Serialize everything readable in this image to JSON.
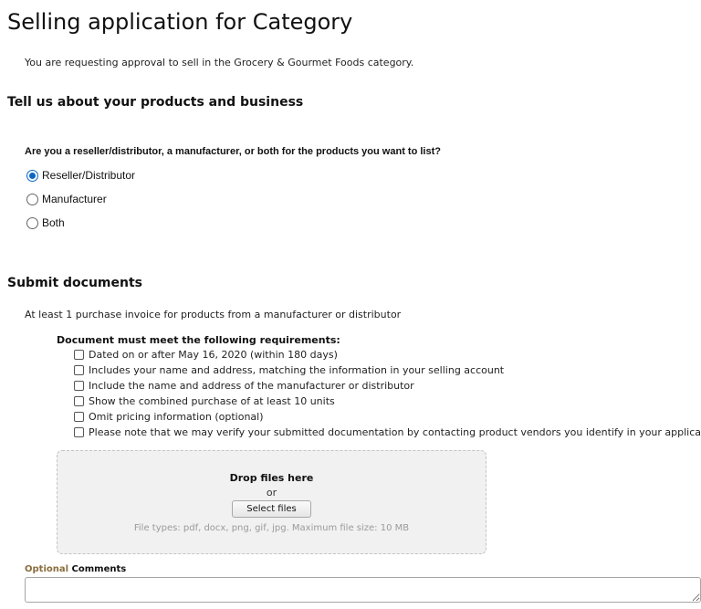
{
  "header": {
    "title": "Selling application for Category",
    "intro": "You are requesting approval to sell in the Grocery & Gourmet Foods category."
  },
  "business_section": {
    "heading": "Tell us about your products and business",
    "question": "Are you a reseller/distributor, a manufacturer, or both for the products you want to list?",
    "options": [
      {
        "label": "Reseller/Distributor",
        "selected": true
      },
      {
        "label": "Manufacturer",
        "selected": false
      },
      {
        "label": "Both",
        "selected": false
      }
    ]
  },
  "documents_section": {
    "heading": "Submit documents",
    "intro": "At least 1 purchase invoice for products from a manufacturer or distributor",
    "requirements_title": "Document must meet the following requirements:",
    "requirements": [
      "Dated on or after May 16, 2020 (within 180 days)",
      "Includes your name and address, matching the information in your selling account",
      "Include the name and address of the manufacturer or distributor",
      "Show the combined purchase of at least 10 units",
      "Omit pricing information (optional)",
      "Please note that we may verify your submitted documentation by contacting product vendors you identify in your application."
    ]
  },
  "upload": {
    "drop_title": "Drop files here",
    "or": "or",
    "button_label": "Select files",
    "hint": "File types: pdf, docx, png, gif, jpg. Maximum file size: 10 MB"
  },
  "comments": {
    "optional_label": "Optional",
    "label": "Comments",
    "value": ""
  },
  "colors": {
    "accent": "#0a66c2",
    "optional": "#8a6d3b"
  }
}
